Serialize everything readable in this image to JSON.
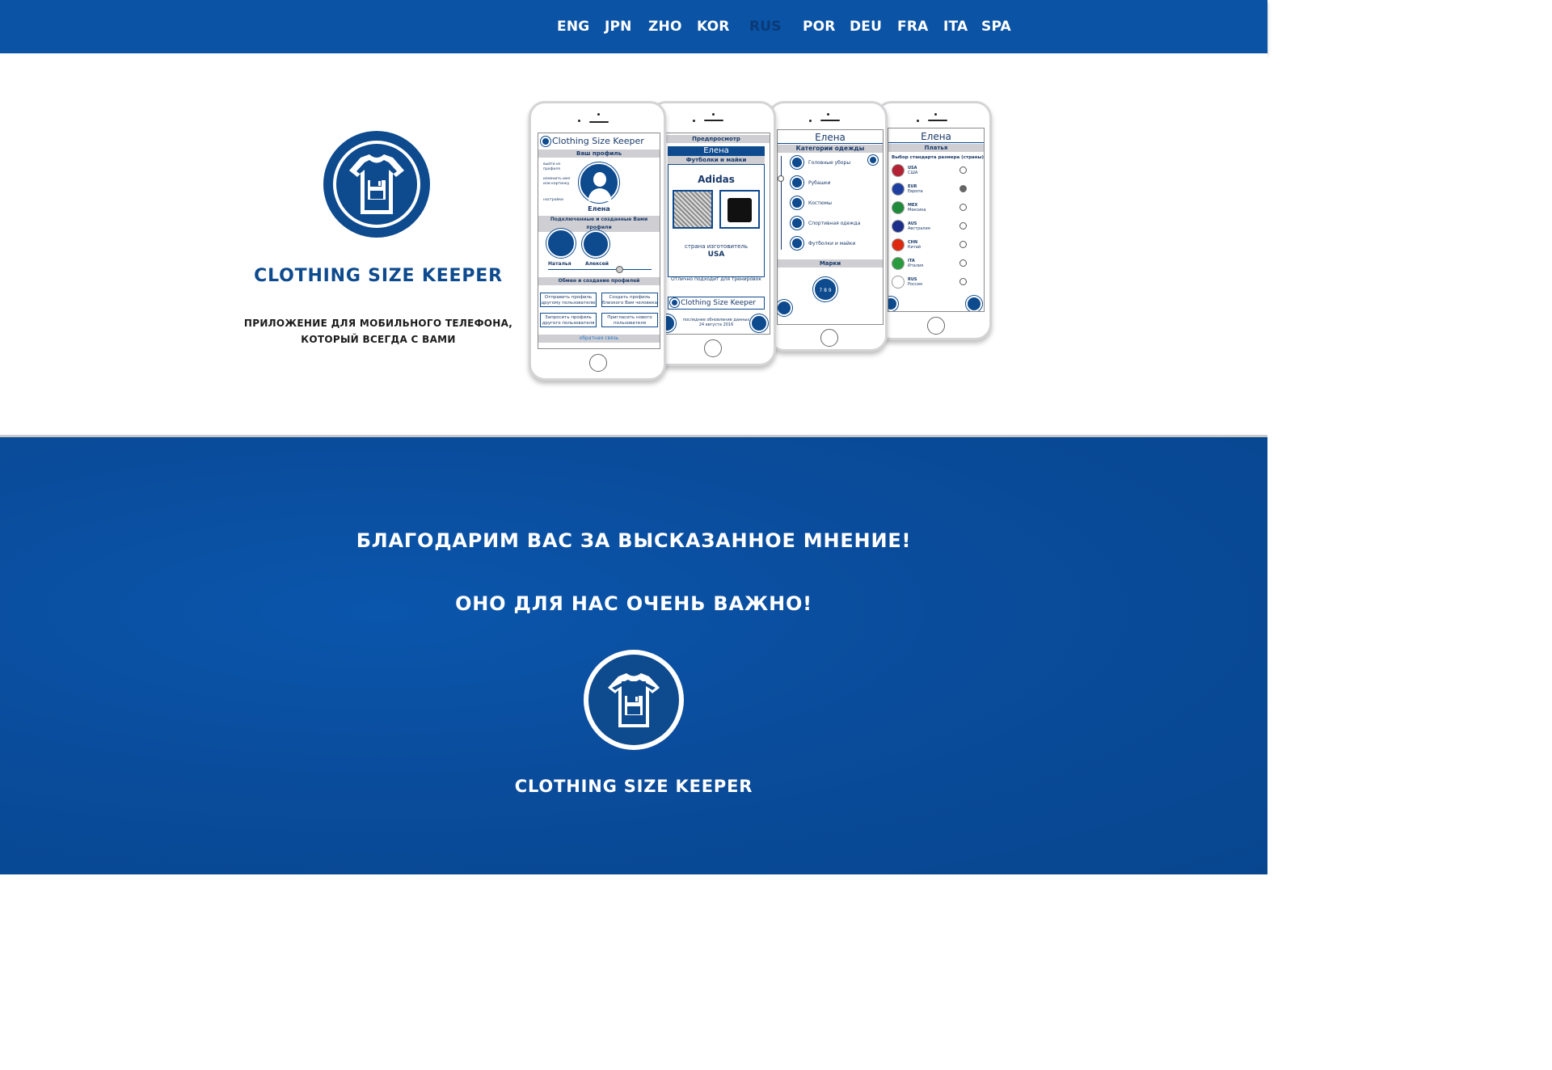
{
  "nav": {
    "languages": [
      "ENG",
      "JPN",
      "ZHO",
      "KOR",
      "RUS",
      "POR",
      "DEU",
      "FRA",
      "ITA",
      "SPA"
    ],
    "active": "RUS"
  },
  "hero": {
    "title": "CLOTHING SIZE KEEPER",
    "tagline_line1": "ПРИЛОЖЕНИЕ ДЛЯ МОБИЛЬНОГО ТЕЛЕФОНА,",
    "tagline_line2": "КОТОРЫЙ ВСЕГДА С ВАМИ"
  },
  "phones": {
    "p1": {
      "app_name": "Clothing Size Keeper",
      "profile_bar": "Ваш профиль",
      "side_1": "выйти из профиля",
      "side_2": "изменить имя или картинку",
      "side_3": "настройки",
      "user_name": "Елена",
      "linked_bar": "Подключенные и созданные Вами профили",
      "friend_1": "Наталья",
      "friend_2": "Алексей",
      "exchange_bar": "Обмен и создание профилей",
      "btn_1": "Отправить профиль другому пользователю",
      "btn_2": "Создать профиль близкого Вам человека",
      "btn_3": "Запросить профиль другого пользователя",
      "btn_4": "Пригласить нового пользователя",
      "feedback": "обратная связь"
    },
    "p2": {
      "preview_bar": "Предпросмотр",
      "user_name": "Елена",
      "category": "Футболки и майки",
      "brand": "Adidas",
      "origin_label": "страна изготовитель",
      "origin_value": "USA",
      "note": "Отлично подходит для тренировок",
      "app_name": "Clothing Size Keeper",
      "updated": "последнее обновление данных 24 августа 2016"
    },
    "p3": {
      "user_name": "Елена",
      "categories_bar": "Категории одежды",
      "categories": [
        "Головные уборы",
        "Рубашки",
        "Костюмы",
        "Спортивная одежда",
        "Футболки и майки"
      ],
      "brands_bar": "Марки",
      "brand_badge": "7 8 9"
    },
    "p4": {
      "user_name": "Елена",
      "section_bar": "Платья",
      "standard_label": "Выбор стандарта размера (страны)",
      "standards": [
        {
          "code": "USA",
          "name": "США",
          "flag": "#b22234",
          "selected": false
        },
        {
          "code": "EUR",
          "name": "Европа",
          "flag": "#1f3fa0",
          "selected": true
        },
        {
          "code": "MEX",
          "name": "Мексика",
          "flag": "#1f8a3a",
          "selected": false
        },
        {
          "code": "AUS",
          "name": "Австралия",
          "flag": "#1b2f8a",
          "selected": false
        },
        {
          "code": "CHN",
          "name": "Китай",
          "flag": "#de2910",
          "selected": false
        },
        {
          "code": "ITA",
          "name": "Италия",
          "flag": "#2a9a3f",
          "selected": false
        },
        {
          "code": "RUS",
          "name": "Россия",
          "flag": "#ffffff",
          "selected": false
        }
      ]
    }
  },
  "thanks": {
    "line1": "БЛАГОДАРИМ ВАС ЗА ВЫСКАЗАННОЕ МНЕНИЕ!",
    "line2": "ОНО ДЛЯ НАС ОЧЕНЬ ВАЖНО!",
    "brand": "CLOTHING SIZE KEEPER"
  },
  "colors": {
    "brand_blue": "#0d4a8e",
    "nav_blue": "#0b53a4",
    "active_lang": "#0a3a78"
  }
}
